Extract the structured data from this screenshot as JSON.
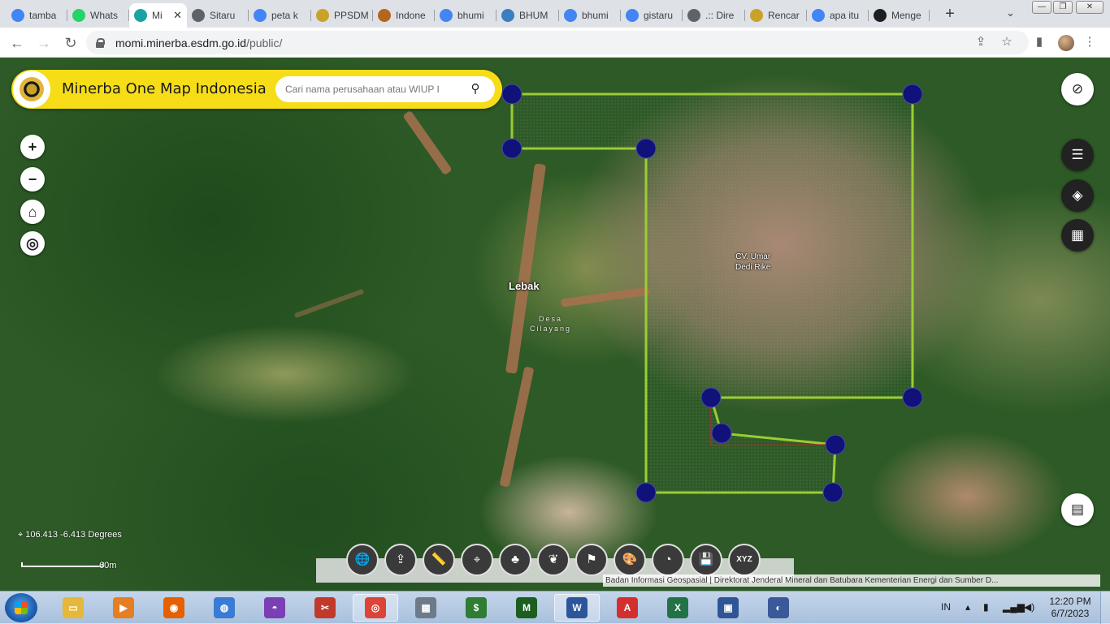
{
  "browser": {
    "tabs": [
      {
        "label": "tamba",
        "icon": "google-icon",
        "color": "#4285f4"
      },
      {
        "label": "Whats",
        "icon": "whatsapp-icon",
        "color": "#25d366"
      },
      {
        "label": "Mi",
        "icon": "momi-icon",
        "color": "#1aa3a3",
        "active": true
      },
      {
        "label": "Sitaru",
        "icon": "globe-icon",
        "color": "#5f6368"
      },
      {
        "label": "peta k",
        "icon": "google-icon",
        "color": "#4285f4"
      },
      {
        "label": "PPSDM",
        "icon": "esdm-icon",
        "color": "#c9a227"
      },
      {
        "label": "Indone",
        "icon": "garuda-icon",
        "color": "#b5651d"
      },
      {
        "label": "bhumi",
        "icon": "google-icon",
        "color": "#4285f4"
      },
      {
        "label": "BHUM",
        "icon": "bhumi-icon",
        "color": "#3a7fc1"
      },
      {
        "label": "bhumi",
        "icon": "google-icon",
        "color": "#4285f4"
      },
      {
        "label": "gistaru",
        "icon": "google-icon",
        "color": "#4285f4"
      },
      {
        "label": ".:: Dire",
        "icon": "globe-icon",
        "color": "#5f6368"
      },
      {
        "label": "Rencar",
        "icon": "esdm-icon",
        "color": "#c9a227"
      },
      {
        "label": "apa itu",
        "icon": "google-icon",
        "color": "#4285f4"
      },
      {
        "label": "Menge",
        "icon": "scribd-icon",
        "color": "#1e1e1e"
      }
    ],
    "url_host": "momi.minerba.esdm.go.id",
    "url_path": "/public/"
  },
  "app": {
    "title": "Minerba One Map Indonesia",
    "search_placeholder": "Cari nama perusahaan atau WIUP I",
    "accent_color": "#f6dd18"
  },
  "map": {
    "labels": {
      "region": "Lebak",
      "village_line1": "Desa",
      "village_line2": "Cilayang",
      "concession_line1": "CV. Umar",
      "concession_line2": "Dedi Rike"
    },
    "coordinates_readout": "106.413 -6.413 Degrees",
    "scale_label": "60m",
    "attribution": "Badan Informasi Geospasial | Direktorat Jenderal Mineral dan Batubara Kementerian Energi dan Sumber D...",
    "polygon_color": "#9acd32",
    "vertex_color": "#10127a",
    "left_controls": [
      {
        "name": "zoom-in",
        "glyph": "+"
      },
      {
        "name": "zoom-out",
        "glyph": "−"
      },
      {
        "name": "home",
        "glyph": "⌂"
      },
      {
        "name": "locate",
        "glyph": "◎"
      }
    ],
    "right_controls": [
      {
        "name": "hide-visibility",
        "glyph": "⊘"
      },
      {
        "name": "legend-list",
        "glyph": "☰"
      },
      {
        "name": "layers",
        "glyph": "◈"
      },
      {
        "name": "basemap-grid",
        "glyph": "▦"
      },
      {
        "name": "attribute-table",
        "glyph": "▤"
      }
    ],
    "bottom_tools": [
      {
        "name": "globe",
        "glyph": "🌐"
      },
      {
        "name": "upload-map",
        "glyph": "⇪"
      },
      {
        "name": "measure-ruler",
        "glyph": "📏"
      },
      {
        "name": "draw-area",
        "glyph": "⌖"
      },
      {
        "name": "tree-analysis",
        "glyph": "♣"
      },
      {
        "name": "leaf",
        "glyph": "❦"
      },
      {
        "name": "map-filter",
        "glyph": "⚑"
      },
      {
        "name": "palette",
        "glyph": "🎨"
      },
      {
        "name": "chart-report",
        "glyph": "◔"
      },
      {
        "name": "save",
        "glyph": "💾"
      },
      {
        "name": "xyz-coordinates",
        "glyph": "XYZ"
      }
    ]
  },
  "taskbar": {
    "apps": [
      {
        "name": "explorer",
        "color": "#e5b73b",
        "glyph": "▭"
      },
      {
        "name": "media-player",
        "color": "#e67e22",
        "glyph": "▶"
      },
      {
        "name": "firefox",
        "color": "#e66000",
        "glyph": "◉"
      },
      {
        "name": "google-earth",
        "color": "#3a7bd5",
        "glyph": "◍"
      },
      {
        "name": "mask-app",
        "color": "#7b3fb5",
        "glyph": "◓"
      },
      {
        "name": "snipping-tool",
        "color": "#c0392b",
        "glyph": "✂"
      },
      {
        "name": "chrome",
        "color": "#db4437",
        "glyph": "◎",
        "pinned": true
      },
      {
        "name": "calculator",
        "color": "#6c7a89",
        "glyph": "▦"
      },
      {
        "name": "metatrader",
        "color": "#2e7d32",
        "glyph": "$"
      },
      {
        "name": "monex",
        "color": "#1b5e20",
        "glyph": "M"
      },
      {
        "name": "word",
        "color": "#2b579a",
        "glyph": "W",
        "pinned": true
      },
      {
        "name": "acrobat",
        "color": "#d32f2f",
        "glyph": "A"
      },
      {
        "name": "excel",
        "color": "#217346",
        "glyph": "X"
      },
      {
        "name": "access-app",
        "color": "#2f5597",
        "glyph": "▣"
      },
      {
        "name": "earth-globe",
        "color": "#3b5998",
        "glyph": "◐"
      }
    ],
    "language": "IN",
    "time": "12:20 PM",
    "date": "6/7/2023"
  }
}
